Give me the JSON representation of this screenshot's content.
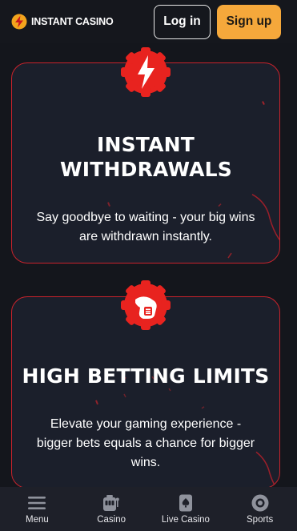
{
  "header": {
    "logo_text": "INSTANT CASINO",
    "login_label": "Log in",
    "signup_label": "Sign up"
  },
  "features": [
    {
      "icon": "lightning-bolt-icon",
      "title": "INSTANT WITHDRAWALS",
      "description": "Say goodbye to waiting - your big wins are withdrawn instantly."
    },
    {
      "icon": "hand-chip-icon",
      "title": "HIGH BETTING LIMITS",
      "description": "Elevate your gaming experience - bigger bets equals a chance for bigger wins."
    }
  ],
  "bottom_nav": [
    {
      "label": "Menu",
      "icon": "menu-icon"
    },
    {
      "label": "Casino",
      "icon": "slot-machine-icon"
    },
    {
      "label": "Live Casino",
      "icon": "spade-card-icon"
    },
    {
      "label": "Sports",
      "icon": "ball-icon"
    }
  ],
  "colors": {
    "background": "#14161c",
    "card": "#1b1f2b",
    "accent_red": "#e8231f",
    "border_red": "#c9232c",
    "signup_orange": "#f5a83b"
  }
}
